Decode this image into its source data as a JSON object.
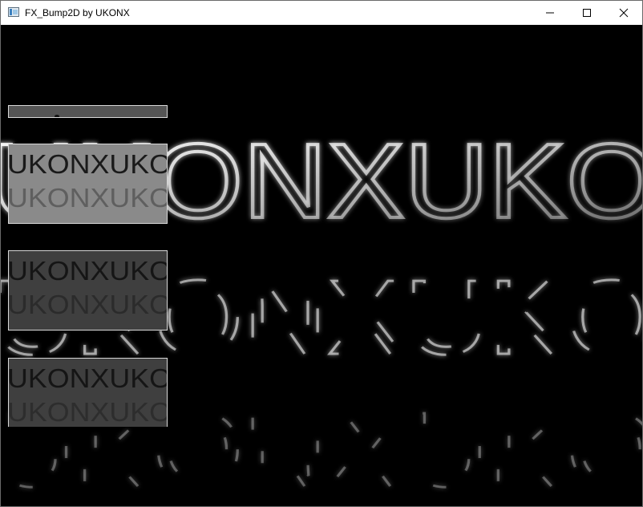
{
  "window": {
    "title": "FX_Bump2D by UKONX"
  },
  "scene": {
    "text_rows": [
      "UKONXUKO",
      "UKONXUKO",
      "UKONXUKO"
    ],
    "background": "#000000",
    "glow_color": "#ffffff"
  },
  "panels": {
    "items": [
      {
        "name": "panel-strip",
        "color": "#555555"
      },
      {
        "name": "height-map",
        "color": "#8a8a8a"
      },
      {
        "name": "normal-x",
        "color": "#3f3f3f"
      },
      {
        "name": "normal-y",
        "color": "#3f3f3f"
      }
    ]
  },
  "icons": {
    "app": "app-window-icon",
    "minimize": "minimize-icon",
    "maximize": "maximize-icon",
    "close": "close-icon"
  }
}
